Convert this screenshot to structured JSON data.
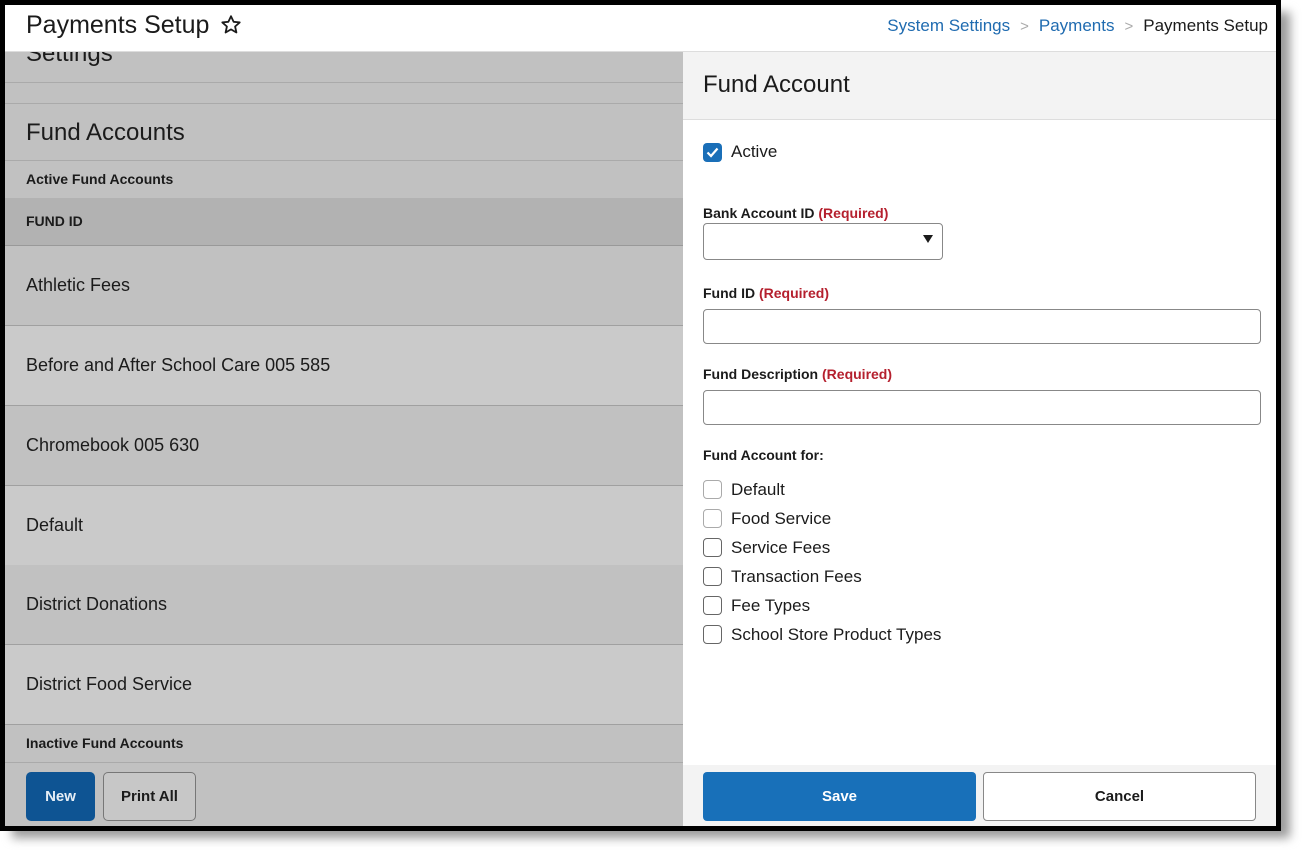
{
  "header": {
    "title": "Payments Setup",
    "favorite_icon": "star-outline-icon",
    "breadcrumb": [
      {
        "label": "System Settings",
        "link": true
      },
      {
        "label": "Payments",
        "link": true
      },
      {
        "label": "Payments Setup",
        "link": false
      }
    ]
  },
  "left_panel": {
    "settings_label": "Settings",
    "title": "Fund Accounts",
    "active_label": "Active Fund Accounts",
    "column_header": "FUND ID",
    "rows": [
      "Athletic Fees",
      "Before and After School Care 005 585",
      "Chromebook 005 630",
      "Default",
      "District Donations",
      "District Food Service"
    ],
    "inactive_label": "Inactive Fund Accounts",
    "buttons": {
      "new": "New",
      "print_all": "Print All"
    }
  },
  "form": {
    "title": "Fund Account",
    "active": {
      "label": "Active",
      "checked": true
    },
    "bank_account": {
      "label": "Bank Account ID",
      "required": "(Required)",
      "value": ""
    },
    "fund_id": {
      "label": "Fund ID",
      "required": "(Required)",
      "value": ""
    },
    "fund_description": {
      "label": "Fund Description",
      "required": "(Required)",
      "value": ""
    },
    "fund_account_for": {
      "label": "Fund Account for:",
      "options": [
        {
          "label": "Default",
          "checked": false
        },
        {
          "label": "Food Service",
          "checked": false
        },
        {
          "label": "Service Fees",
          "checked": false
        },
        {
          "label": "Transaction Fees",
          "checked": false
        },
        {
          "label": "Fee Types",
          "checked": false
        },
        {
          "label": "School Store Product Types",
          "checked": false
        }
      ]
    },
    "buttons": {
      "save": "Save",
      "cancel": "Cancel"
    }
  },
  "colors": {
    "primary": "#1870b9",
    "new_button": "#0e5493",
    "required": "#b5202e",
    "link": "#1f6bb0"
  }
}
